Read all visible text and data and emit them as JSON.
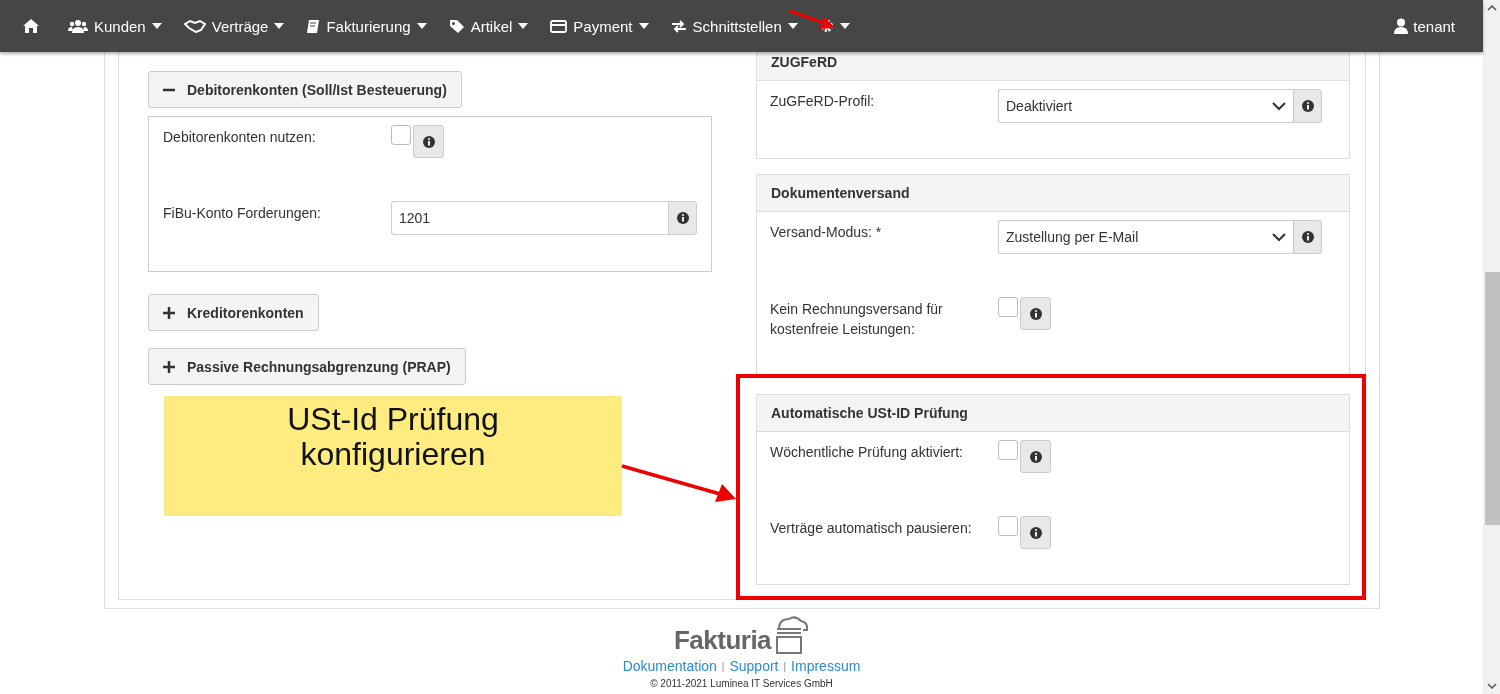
{
  "navbar": {
    "items": [
      {
        "kind": "home"
      },
      {
        "kind": "users",
        "label": "Kunden"
      },
      {
        "kind": "handshake",
        "label": "Verträge"
      },
      {
        "kind": "book",
        "label": "Fakturierung"
      },
      {
        "kind": "tag",
        "label": "Artikel"
      },
      {
        "kind": "card",
        "label": "Payment"
      },
      {
        "kind": "exchange",
        "label": "Schnittstellen"
      },
      {
        "kind": "gear"
      }
    ],
    "user": "tenant"
  },
  "left": [
    {
      "label": "Debitorenkonten (Soll/Ist Besteuerung)",
      "expanded": true,
      "fields": [
        {
          "kind": "checkbox",
          "label": "Debitorenkonten nutzen:",
          "checked": false
        },
        {
          "kind": "text",
          "label": "FiBu-Konto Forderungen:",
          "value": "1201"
        }
      ]
    },
    {
      "label": "Kreditorenkonten",
      "expanded": false
    },
    {
      "label": "Passive Rechnungsabgrenzung (PRAP)",
      "expanded": false
    }
  ],
  "right": [
    {
      "title": "ZUGFeRD",
      "fields": [
        {
          "kind": "select",
          "label": "ZuGFeRD-Profil:",
          "value": "Deaktiviert"
        }
      ]
    },
    {
      "title": "Dokumentenversand",
      "fields": [
        {
          "kind": "select",
          "label": "Versand-Modus:  *",
          "value": "Zustellung per E-Mail"
        },
        {
          "kind": "checkbox",
          "label": "Kein Rechnungsversand für kostenfreie Leistungen:",
          "checked": false
        }
      ]
    },
    {
      "title": "Automatische USt-ID Prüfung",
      "fields": [
        {
          "kind": "checkbox",
          "label": "Wöchentliche Prüfung aktiviert:",
          "checked": false
        },
        {
          "kind": "checkbox",
          "label": "Verträge automatisch pausieren:",
          "checked": false
        }
      ]
    }
  ],
  "footer": {
    "logo": "Fakturia",
    "items": [
      {
        "kind": "link",
        "text": "Dokumentation"
      },
      {
        "kind": "separator",
        "text": "|"
      },
      {
        "kind": "link",
        "text": "Support"
      },
      {
        "kind": "separator",
        "text": "|"
      },
      {
        "kind": "link",
        "text": "Impressum"
      }
    ],
    "copyright": "© 2011-2021 Luminea IT Services GmbH"
  },
  "annotation": {
    "callout": "USt-Id Prüfung konfigurieren"
  }
}
